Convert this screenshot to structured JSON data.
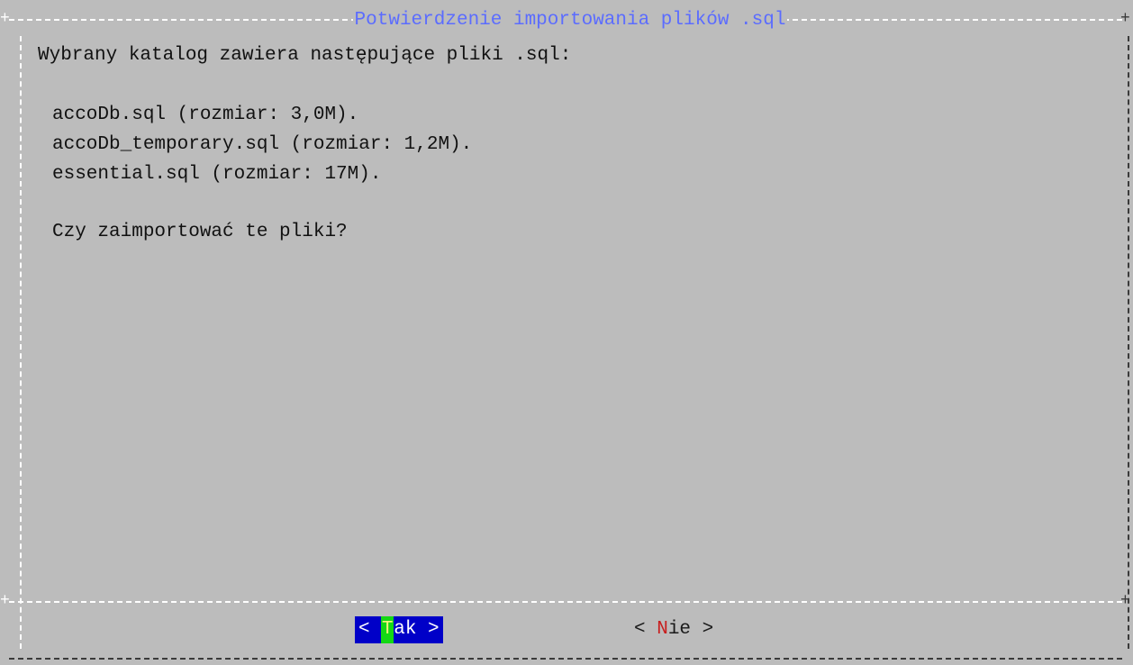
{
  "dialog": {
    "title": "Potwierdzenie importowania plików .sql",
    "intro": "Wybrany katalog zawiera następujące pliki .sql:",
    "files": [
      "accoDb.sql (rozmiar: 3,0M).",
      "accoDb_temporary.sql (rozmiar: 1,2M).",
      "essential.sql (rozmiar: 17M)."
    ],
    "question": "Czy zaimportować te pliki?"
  },
  "buttons": {
    "yes": {
      "open": "< ",
      "hotkey": "T",
      "rest": "ak >"
    },
    "no": {
      "open": "< ",
      "hotkey": "N",
      "rest": "ie >"
    }
  },
  "colors": {
    "background": "#bcbcbc",
    "title": "#5b6cff",
    "button_selected_bg": "#0000c8",
    "hotkey_selected_bg": "#14d814",
    "hotkey_unselected": "#c81e1e"
  }
}
